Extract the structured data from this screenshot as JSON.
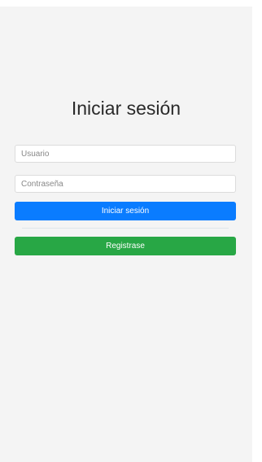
{
  "login": {
    "title": "Iniciar sesión",
    "username": {
      "value": "",
      "placeholder": "Usuario"
    },
    "password": {
      "value": "",
      "placeholder": "Contraseña"
    },
    "login_button_label": "Iniciar sesión",
    "register_button_label": "Registrase"
  },
  "colors": {
    "primary": "#0a7cff",
    "success": "#28a745",
    "background": "#f4f4f4"
  }
}
